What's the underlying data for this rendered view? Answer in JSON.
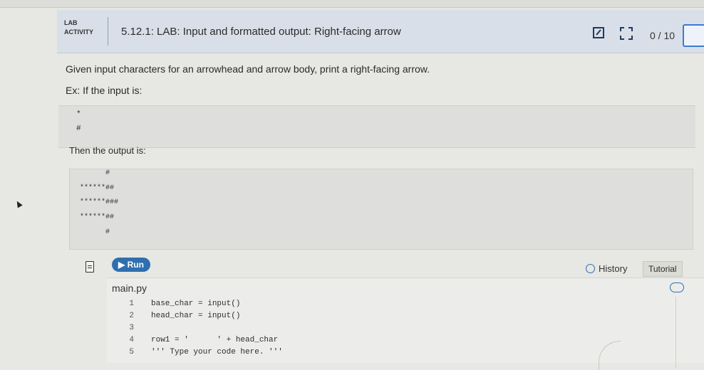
{
  "header": {
    "lab_line1": "LAB",
    "lab_line2": "ACTIVITY",
    "title": "5.12.1: LAB: Input and formatted output: Right-facing arrow",
    "score": "0 / 10"
  },
  "content": {
    "description": "Given input characters for an arrowhead and arrow body, print a right-facing arrow.",
    "example_intro": "Ex: If the input is:",
    "input_lines": [
      "*",
      "#"
    ],
    "output_intro": "Then the output is:",
    "output_lines": [
      "      #",
      "******##",
      "******###",
      "******##",
      "      #"
    ]
  },
  "toolbar": {
    "run_label": "▶ Run",
    "history_label": "History",
    "tutorial_label": "Tutorial"
  },
  "editor": {
    "filename": "main.py",
    "lines": [
      {
        "num": "1",
        "text": "base_char = input()"
      },
      {
        "num": "2",
        "text": "head_char = input()"
      },
      {
        "num": "3",
        "text": ""
      },
      {
        "num": "4",
        "text": "row1 = '      ' + head_char"
      },
      {
        "num": "5",
        "text": "''' Type your code here. '''"
      }
    ]
  },
  "colors": {
    "accent": "#2f6fb0",
    "header_bg": "#d9dfe8"
  }
}
